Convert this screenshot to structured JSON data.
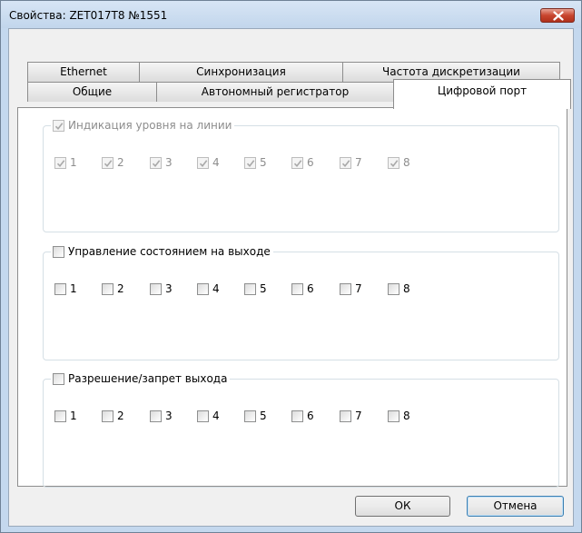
{
  "window": {
    "title": "Свойства: ZET017T8 №1551"
  },
  "icons": {
    "close": "close-x-icon",
    "check": "checkmark-icon"
  },
  "tabs": {
    "row_top": [
      "Ethernet",
      "Синхронизация",
      "Частота дискретизации"
    ],
    "row_bottom": [
      "Общие",
      "Автономный регистратор",
      "Цифровой порт"
    ],
    "active": "Цифровой порт"
  },
  "groups": [
    {
      "label": "Индикация уровня на линии",
      "header_checked": true,
      "enabled": false,
      "items": [
        {
          "label": "1",
          "checked": true
        },
        {
          "label": "2",
          "checked": true
        },
        {
          "label": "3",
          "checked": true
        },
        {
          "label": "4",
          "checked": true
        },
        {
          "label": "5",
          "checked": true
        },
        {
          "label": "6",
          "checked": true
        },
        {
          "label": "7",
          "checked": true
        },
        {
          "label": "8",
          "checked": true
        }
      ]
    },
    {
      "label": "Управление состоянием на выходе",
      "header_checked": false,
      "enabled": true,
      "items": [
        {
          "label": "1",
          "checked": false
        },
        {
          "label": "2",
          "checked": false
        },
        {
          "label": "3",
          "checked": false
        },
        {
          "label": "4",
          "checked": false
        },
        {
          "label": "5",
          "checked": false
        },
        {
          "label": "6",
          "checked": false
        },
        {
          "label": "7",
          "checked": false
        },
        {
          "label": "8",
          "checked": false
        }
      ]
    },
    {
      "label": "Разрешение/запрет выхода",
      "header_checked": false,
      "enabled": true,
      "items": [
        {
          "label": "1",
          "checked": false
        },
        {
          "label": "2",
          "checked": false
        },
        {
          "label": "3",
          "checked": false
        },
        {
          "label": "4",
          "checked": false
        },
        {
          "label": "5",
          "checked": false
        },
        {
          "label": "6",
          "checked": false
        },
        {
          "label": "7",
          "checked": false
        },
        {
          "label": "8",
          "checked": false
        }
      ]
    }
  ],
  "buttons": {
    "ok": "ОК",
    "cancel": "Отмена"
  },
  "colors": {
    "titlebar": "#c4d8ee",
    "close": "#c8452e",
    "disabled_text": "#8d8d8d",
    "default_button_border": "#3c7fb1"
  }
}
